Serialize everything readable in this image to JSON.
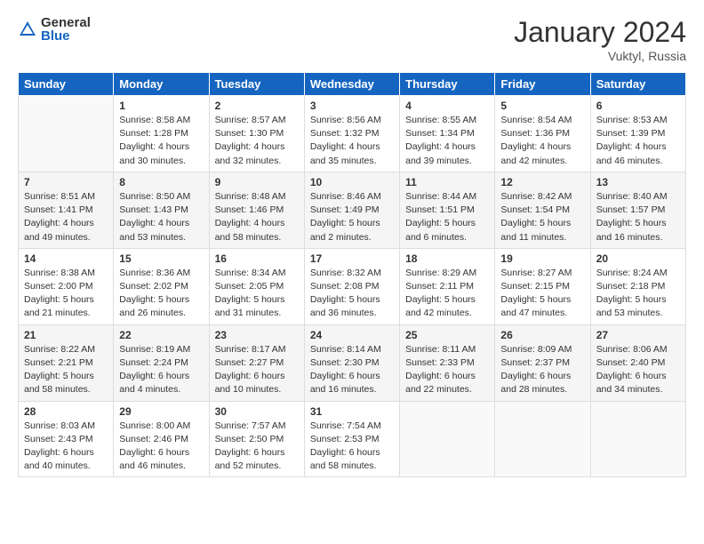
{
  "logo": {
    "general": "General",
    "blue": "Blue"
  },
  "title": "January 2024",
  "subtitle": "Vuktyl, Russia",
  "headers": [
    "Sunday",
    "Monday",
    "Tuesday",
    "Wednesday",
    "Thursday",
    "Friday",
    "Saturday"
  ],
  "weeks": [
    [
      {
        "day": "",
        "info": ""
      },
      {
        "day": "1",
        "info": "Sunrise: 8:58 AM\nSunset: 1:28 PM\nDaylight: 4 hours\nand 30 minutes."
      },
      {
        "day": "2",
        "info": "Sunrise: 8:57 AM\nSunset: 1:30 PM\nDaylight: 4 hours\nand 32 minutes."
      },
      {
        "day": "3",
        "info": "Sunrise: 8:56 AM\nSunset: 1:32 PM\nDaylight: 4 hours\nand 35 minutes."
      },
      {
        "day": "4",
        "info": "Sunrise: 8:55 AM\nSunset: 1:34 PM\nDaylight: 4 hours\nand 39 minutes."
      },
      {
        "day": "5",
        "info": "Sunrise: 8:54 AM\nSunset: 1:36 PM\nDaylight: 4 hours\nand 42 minutes."
      },
      {
        "day": "6",
        "info": "Sunrise: 8:53 AM\nSunset: 1:39 PM\nDaylight: 4 hours\nand 46 minutes."
      }
    ],
    [
      {
        "day": "7",
        "info": "Sunrise: 8:51 AM\nSunset: 1:41 PM\nDaylight: 4 hours\nand 49 minutes."
      },
      {
        "day": "8",
        "info": "Sunrise: 8:50 AM\nSunset: 1:43 PM\nDaylight: 4 hours\nand 53 minutes."
      },
      {
        "day": "9",
        "info": "Sunrise: 8:48 AM\nSunset: 1:46 PM\nDaylight: 4 hours\nand 58 minutes."
      },
      {
        "day": "10",
        "info": "Sunrise: 8:46 AM\nSunset: 1:49 PM\nDaylight: 5 hours\nand 2 minutes."
      },
      {
        "day": "11",
        "info": "Sunrise: 8:44 AM\nSunset: 1:51 PM\nDaylight: 5 hours\nand 6 minutes."
      },
      {
        "day": "12",
        "info": "Sunrise: 8:42 AM\nSunset: 1:54 PM\nDaylight: 5 hours\nand 11 minutes."
      },
      {
        "day": "13",
        "info": "Sunrise: 8:40 AM\nSunset: 1:57 PM\nDaylight: 5 hours\nand 16 minutes."
      }
    ],
    [
      {
        "day": "14",
        "info": "Sunrise: 8:38 AM\nSunset: 2:00 PM\nDaylight: 5 hours\nand 21 minutes."
      },
      {
        "day": "15",
        "info": "Sunrise: 8:36 AM\nSunset: 2:02 PM\nDaylight: 5 hours\nand 26 minutes."
      },
      {
        "day": "16",
        "info": "Sunrise: 8:34 AM\nSunset: 2:05 PM\nDaylight: 5 hours\nand 31 minutes."
      },
      {
        "day": "17",
        "info": "Sunrise: 8:32 AM\nSunset: 2:08 PM\nDaylight: 5 hours\nand 36 minutes."
      },
      {
        "day": "18",
        "info": "Sunrise: 8:29 AM\nSunset: 2:11 PM\nDaylight: 5 hours\nand 42 minutes."
      },
      {
        "day": "19",
        "info": "Sunrise: 8:27 AM\nSunset: 2:15 PM\nDaylight: 5 hours\nand 47 minutes."
      },
      {
        "day": "20",
        "info": "Sunrise: 8:24 AM\nSunset: 2:18 PM\nDaylight: 5 hours\nand 53 minutes."
      }
    ],
    [
      {
        "day": "21",
        "info": "Sunrise: 8:22 AM\nSunset: 2:21 PM\nDaylight: 5 hours\nand 58 minutes."
      },
      {
        "day": "22",
        "info": "Sunrise: 8:19 AM\nSunset: 2:24 PM\nDaylight: 6 hours\nand 4 minutes."
      },
      {
        "day": "23",
        "info": "Sunrise: 8:17 AM\nSunset: 2:27 PM\nDaylight: 6 hours\nand 10 minutes."
      },
      {
        "day": "24",
        "info": "Sunrise: 8:14 AM\nSunset: 2:30 PM\nDaylight: 6 hours\nand 16 minutes."
      },
      {
        "day": "25",
        "info": "Sunrise: 8:11 AM\nSunset: 2:33 PM\nDaylight: 6 hours\nand 22 minutes."
      },
      {
        "day": "26",
        "info": "Sunrise: 8:09 AM\nSunset: 2:37 PM\nDaylight: 6 hours\nand 28 minutes."
      },
      {
        "day": "27",
        "info": "Sunrise: 8:06 AM\nSunset: 2:40 PM\nDaylight: 6 hours\nand 34 minutes."
      }
    ],
    [
      {
        "day": "28",
        "info": "Sunrise: 8:03 AM\nSunset: 2:43 PM\nDaylight: 6 hours\nand 40 minutes."
      },
      {
        "day": "29",
        "info": "Sunrise: 8:00 AM\nSunset: 2:46 PM\nDaylight: 6 hours\nand 46 minutes."
      },
      {
        "day": "30",
        "info": "Sunrise: 7:57 AM\nSunset: 2:50 PM\nDaylight: 6 hours\nand 52 minutes."
      },
      {
        "day": "31",
        "info": "Sunrise: 7:54 AM\nSunset: 2:53 PM\nDaylight: 6 hours\nand 58 minutes."
      },
      {
        "day": "",
        "info": ""
      },
      {
        "day": "",
        "info": ""
      },
      {
        "day": "",
        "info": ""
      }
    ]
  ]
}
